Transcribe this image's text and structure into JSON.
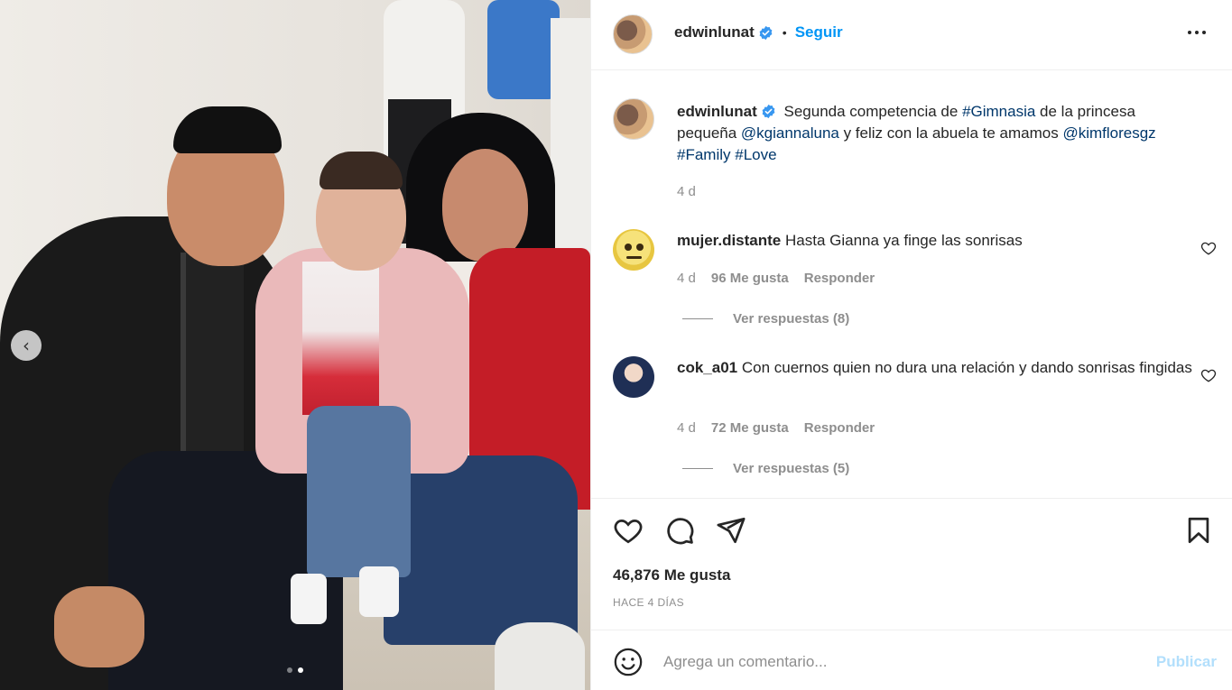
{
  "post": {
    "owner": "edwinlunat",
    "separator": "•",
    "follow_label": "Seguir",
    "more_icon": "more-horizontal-icon",
    "caption": {
      "user": "edwinlunat",
      "text_1": "Segunda competencia de ",
      "tag_1": "#Gimnasia",
      "text_2": " de la princesa pequeña ",
      "tag_2": "@kgiannaluna",
      "text_3": " y feliz con la abuela te amamos ",
      "tag_3": "@kimfloresgz",
      "text_4": " ",
      "tag_4": "#Family",
      "text_5": " ",
      "tag_5": "#Love",
      "age": "4 d"
    },
    "comments": [
      {
        "user": "mujer.distante",
        "text": "Hasta Gianna ya finge las sonrisas",
        "age": "4 d",
        "likes": "96 Me gusta",
        "reply_label": "Responder",
        "view_replies": "Ver respuestas (8)"
      },
      {
        "user": "cok_a01",
        "text": "Con cuernos quien no dura una relación y dando sonrisas fingidas",
        "age": "4 d",
        "likes": "72 Me gusta",
        "reply_label": "Responder",
        "view_replies": "Ver respuestas (5)"
      }
    ],
    "likes_count": "46,876 Me gusta",
    "date": "HACE 4 DÍAS",
    "add_comment": {
      "placeholder": "Agrega un comentario...",
      "publish_label": "Publicar"
    },
    "carousel": {
      "prev_icon": "chevron-left-icon",
      "prev_glyph": "‹",
      "current_index": 2,
      "total": 2
    }
  },
  "colors": {
    "accent": "#0095f6",
    "tag": "#00376b",
    "muted": "#8e8e8e",
    "publish_disabled": "#b2dffc",
    "verified": "#3897f0"
  }
}
